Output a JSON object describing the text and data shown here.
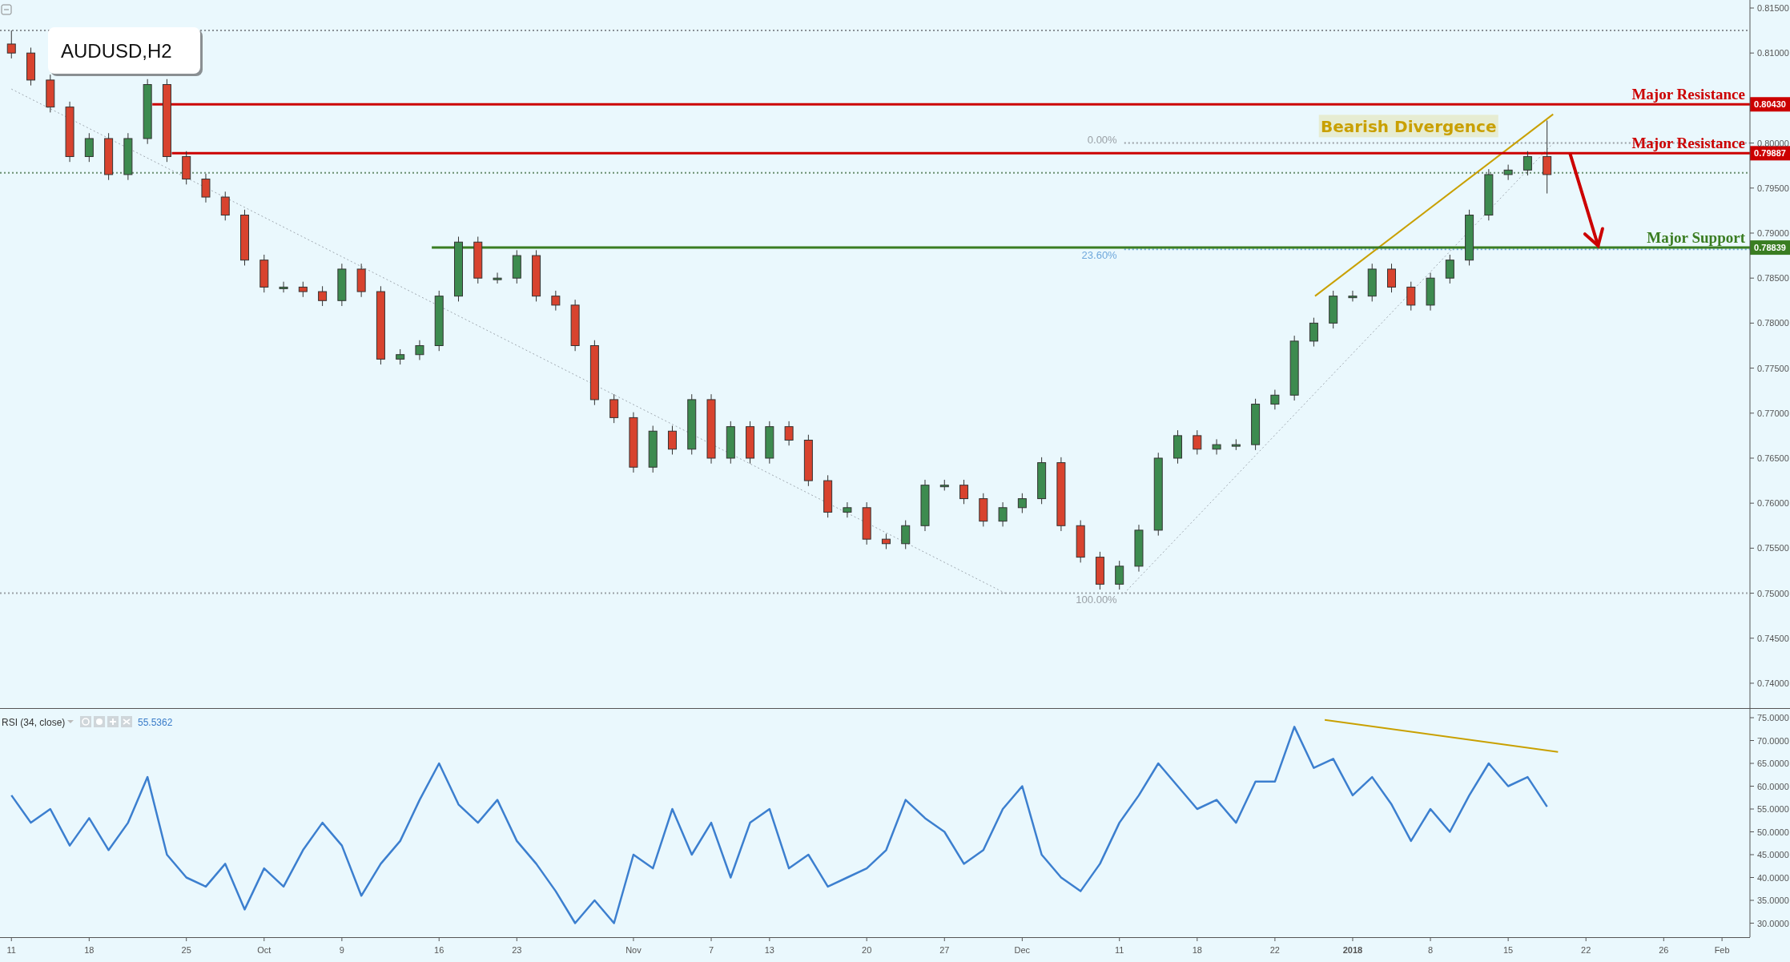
{
  "symbol": "AUDUSD,H2",
  "price_pane": {
    "chart_data": {
      "type": "candlestick",
      "ylim": [
        0.73715,
        0.81589
      ],
      "categories": [
        null,
        null,
        null,
        null,
        null,
        null,
        null,
        null,
        null,
        null,
        null,
        null,
        null,
        null,
        null,
        null,
        null,
        null,
        null,
        null,
        null,
        null,
        null,
        null,
        null,
        null,
        null,
        null,
        null,
        null,
        null,
        null,
        null,
        null,
        null,
        null,
        null,
        null,
        null,
        null,
        null,
        null,
        null,
        null,
        null,
        null,
        null,
        null,
        null,
        null,
        null,
        null,
        null,
        null,
        null,
        null,
        null,
        null,
        null,
        null,
        null,
        null,
        null,
        null,
        null,
        null,
        null,
        null,
        null,
        null,
        null,
        null,
        null,
        null,
        null,
        null,
        null,
        null,
        null,
        null,
        null,
        null,
        null,
        null,
        null,
        null,
        null,
        null,
        null
      ],
      "ohlc": [
        [
          0.811,
          0.8125,
          0.8094,
          0.81
        ],
        [
          0.81,
          0.8106,
          0.8064,
          0.807
        ],
        [
          0.807,
          0.8076,
          0.8034,
          0.804
        ],
        [
          0.804,
          0.8046,
          0.7979,
          0.7985
        ],
        [
          0.7985,
          0.8011,
          0.7979,
          0.8005
        ],
        [
          0.8005,
          0.8011,
          0.7959,
          0.7965
        ],
        [
          0.7965,
          0.8011,
          0.7959,
          0.8005
        ],
        [
          0.8005,
          0.8071,
          0.7999,
          0.8065
        ],
        [
          0.8065,
          0.8071,
          0.7979,
          0.7985
        ],
        [
          0.7985,
          0.7991,
          0.7954,
          0.796
        ],
        [
          0.796,
          0.7966,
          0.7934,
          0.794
        ],
        [
          0.794,
          0.7946,
          0.7914,
          0.792
        ],
        [
          0.792,
          0.7926,
          0.7864,
          0.787
        ],
        [
          0.787,
          0.7876,
          0.7834,
          0.784
        ],
        [
          0.784,
          0.7846,
          0.7834,
          0.784
        ],
        [
          0.784,
          0.7846,
          0.7829,
          0.7835
        ],
        [
          0.7835,
          0.7841,
          0.7819,
          0.7825
        ],
        [
          0.7825,
          0.7866,
          0.7819,
          0.786
        ],
        [
          0.786,
          0.7866,
          0.7829,
          0.7835
        ],
        [
          0.7835,
          0.7841,
          0.7754,
          0.776
        ],
        [
          0.776,
          0.7771,
          0.7754,
          0.7765
        ],
        [
          0.7765,
          0.7781,
          0.7759,
          0.7775
        ],
        [
          0.7775,
          0.7836,
          0.7769,
          0.783
        ],
        [
          0.783,
          0.7896,
          0.7824,
          0.789
        ],
        [
          0.789,
          0.7896,
          0.7844,
          0.785
        ],
        [
          0.785,
          0.7856,
          0.7844,
          0.785
        ],
        [
          0.785,
          0.7881,
          0.7844,
          0.7875
        ],
        [
          0.7875,
          0.7881,
          0.7824,
          0.783
        ],
        [
          0.783,
          0.7836,
          0.7814,
          0.782
        ],
        [
          0.782,
          0.7826,
          0.7769,
          0.7775
        ],
        [
          0.7775,
          0.7781,
          0.7709,
          0.7715
        ],
        [
          0.7715,
          0.7721,
          0.7689,
          0.7695
        ],
        [
          0.7695,
          0.7701,
          0.7634,
          0.764
        ],
        [
          0.764,
          0.7686,
          0.7634,
          0.768
        ],
        [
          0.768,
          0.7686,
          0.7654,
          0.766
        ],
        [
          0.766,
          0.7721,
          0.7654,
          0.7715
        ],
        [
          0.7715,
          0.7721,
          0.7644,
          0.765
        ],
        [
          0.765,
          0.7691,
          0.7644,
          0.7685
        ],
        [
          0.7685,
          0.7691,
          0.7644,
          0.765
        ],
        [
          0.765,
          0.7691,
          0.7644,
          0.7685
        ],
        [
          0.7685,
          0.7691,
          0.7664,
          0.767
        ],
        [
          0.767,
          0.7676,
          0.7619,
          0.7625
        ],
        [
          0.7625,
          0.7631,
          0.7584,
          0.759
        ],
        [
          0.759,
          0.7601,
          0.7584,
          0.7595
        ],
        [
          0.7595,
          0.7601,
          0.7554,
          0.756
        ],
        [
          0.756,
          0.7566,
          0.7549,
          0.7555
        ],
        [
          0.7555,
          0.7581,
          0.7549,
          0.7575
        ],
        [
          0.7575,
          0.7626,
          0.7569,
          0.762
        ],
        [
          0.762,
          0.7626,
          0.7614,
          0.762
        ],
        [
          0.762,
          0.7626,
          0.7599,
          0.7605
        ],
        [
          0.7605,
          0.7611,
          0.7574,
          0.758
        ],
        [
          0.758,
          0.7601,
          0.7574,
          0.7595
        ],
        [
          0.7595,
          0.7611,
          0.7589,
          0.7605
        ],
        [
          0.7605,
          0.7651,
          0.7599,
          0.7645
        ],
        [
          0.7645,
          0.7651,
          0.7569,
          0.7575
        ],
        [
          0.7575,
          0.7581,
          0.7534,
          0.754
        ],
        [
          0.754,
          0.7546,
          0.7504,
          0.751
        ],
        [
          0.751,
          0.7536,
          0.7504,
          0.753
        ],
        [
          0.753,
          0.7576,
          0.7524,
          0.757
        ],
        [
          0.757,
          0.7656,
          0.7564,
          0.765
        ],
        [
          0.765,
          0.7681,
          0.7644,
          0.7675
        ],
        [
          0.7675,
          0.7681,
          0.7654,
          0.766
        ],
        [
          0.766,
          0.7671,
          0.7654,
          0.7665
        ],
        [
          0.7665,
          0.7671,
          0.7659,
          0.7665
        ],
        [
          0.7665,
          0.7716,
          0.7659,
          0.771
        ],
        [
          0.771,
          0.7726,
          0.7704,
          0.772
        ],
        [
          0.772,
          0.7786,
          0.7714,
          0.778
        ],
        [
          0.778,
          0.7806,
          0.7774,
          0.78
        ],
        [
          0.78,
          0.7836,
          0.7794,
          0.783
        ],
        [
          0.783,
          0.7836,
          0.7824,
          0.783
        ],
        [
          0.783,
          0.7866,
          0.7824,
          0.786
        ],
        [
          0.786,
          0.7866,
          0.7834,
          0.784
        ],
        [
          0.784,
          0.7846,
          0.7814,
          0.782
        ],
        [
          0.782,
          0.7856,
          0.7814,
          0.785
        ],
        [
          0.785,
          0.7876,
          0.7844,
          0.787
        ],
        [
          0.787,
          0.7926,
          0.7864,
          0.792
        ],
        [
          0.792,
          0.7971,
          0.7914,
          0.7965
        ],
        [
          0.7965,
          0.7976,
          0.7959,
          0.797
        ],
        [
          0.797,
          0.7991,
          0.7964,
          0.7985
        ],
        [
          0.7985,
          0.8025,
          0.7944,
          0.7965
        ],
        null,
        null,
        null,
        null,
        null,
        null,
        null,
        null,
        null
      ],
      "yticks": [
        {
          "value": 0.815,
          "label": "0.81500"
        },
        {
          "value": 0.81,
          "label": "0.81000"
        },
        {
          "value": 0.8,
          "label": "0.80000"
        },
        {
          "value": 0.795,
          "label": "0.79500"
        },
        {
          "value": 0.79,
          "label": "0.79000"
        },
        {
          "value": 0.785,
          "label": "0.78500"
        },
        {
          "value": 0.78,
          "label": "0.78000"
        },
        {
          "value": 0.775,
          "label": "0.77500"
        },
        {
          "value": 0.77,
          "label": "0.77000"
        },
        {
          "value": 0.765,
          "label": "0.76500"
        },
        {
          "value": 0.76,
          "label": "0.76000"
        },
        {
          "value": 0.755,
          "label": "0.75500"
        },
        {
          "value": 0.75,
          "label": "0.75000"
        },
        {
          "value": 0.745,
          "label": "0.74500"
        },
        {
          "value": 0.74,
          "label": "0.74000"
        }
      ]
    },
    "levels": [
      {
        "label": "Major Resistance",
        "tag": "0.80430",
        "color": "#cc0000"
      },
      {
        "label": "Major Resistance",
        "tag": "0.79887",
        "color": "#cc0000"
      },
      {
        "label": "Major Support",
        "tag": "0.78839",
        "color": "#3a7d22"
      }
    ],
    "fib_labels": [
      "0.00%",
      "23.60%",
      "100.00%"
    ],
    "callout": "Bearish Divergence"
  },
  "rsi_pane": {
    "legend": {
      "title": "RSI (34, close)",
      "value": "55.5362"
    },
    "chart_data": {
      "type": "line",
      "ylim": [
        26.93,
        76.93
      ],
      "categories": [
        "11",
        null,
        null,
        null,
        "18",
        null,
        null,
        null,
        null,
        "25",
        null,
        null,
        null,
        "Oct",
        null,
        null,
        null,
        "9",
        null,
        null,
        null,
        null,
        "16",
        null,
        null,
        null,
        "23",
        null,
        null,
        null,
        null,
        null,
        "Nov",
        null,
        null,
        null,
        "7",
        null,
        null,
        "13",
        null,
        null,
        null,
        null,
        "20",
        null,
        null,
        null,
        "27",
        null,
        null,
        null,
        "Dec",
        null,
        null,
        null,
        null,
        "11",
        null,
        null,
        null,
        "18",
        null,
        null,
        null,
        "22",
        null,
        null,
        null,
        "2018",
        null,
        null,
        null,
        "8",
        null,
        null,
        null,
        "15",
        null,
        null,
        null,
        "22",
        null,
        null,
        null,
        "26",
        null,
        null,
        "Feb"
      ],
      "series": [
        {
          "color": "#3c7fcf",
          "values": [
            58,
            52,
            55,
            47,
            53,
            46,
            52,
            62,
            45,
            40,
            38,
            43,
            33,
            42,
            38,
            46,
            52,
            47,
            36,
            43,
            48,
            57,
            65,
            56,
            52,
            57,
            48,
            43,
            37,
            30,
            35,
            30,
            45,
            42,
            55,
            45,
            52,
            40,
            52,
            55,
            42,
            45,
            38,
            40,
            42,
            46,
            57,
            53,
            50,
            43,
            46,
            55,
            60,
            45,
            40,
            37,
            43,
            52,
            58,
            65,
            60,
            55,
            57,
            52,
            61,
            61,
            73,
            64,
            66,
            58,
            62,
            56,
            48,
            55,
            50,
            58,
            65,
            60,
            62,
            55.5,
            null,
            null,
            null,
            null,
            null,
            null,
            null,
            null,
            null
          ]
        }
      ],
      "yticks": [
        {
          "value": 75,
          "label": "75.0000"
        },
        {
          "value": 70,
          "label": "70.0000"
        },
        {
          "value": 65,
          "label": "65.0000"
        },
        {
          "value": 60,
          "label": "60.0000"
        },
        {
          "value": 55,
          "label": "55.0000"
        },
        {
          "value": 50,
          "label": "50.0000"
        },
        {
          "value": 45,
          "label": "45.0000"
        },
        {
          "value": 40,
          "label": "40.0000"
        },
        {
          "value": 35,
          "label": "35.0000"
        },
        {
          "value": 30,
          "label": "30.0000"
        }
      ]
    }
  }
}
